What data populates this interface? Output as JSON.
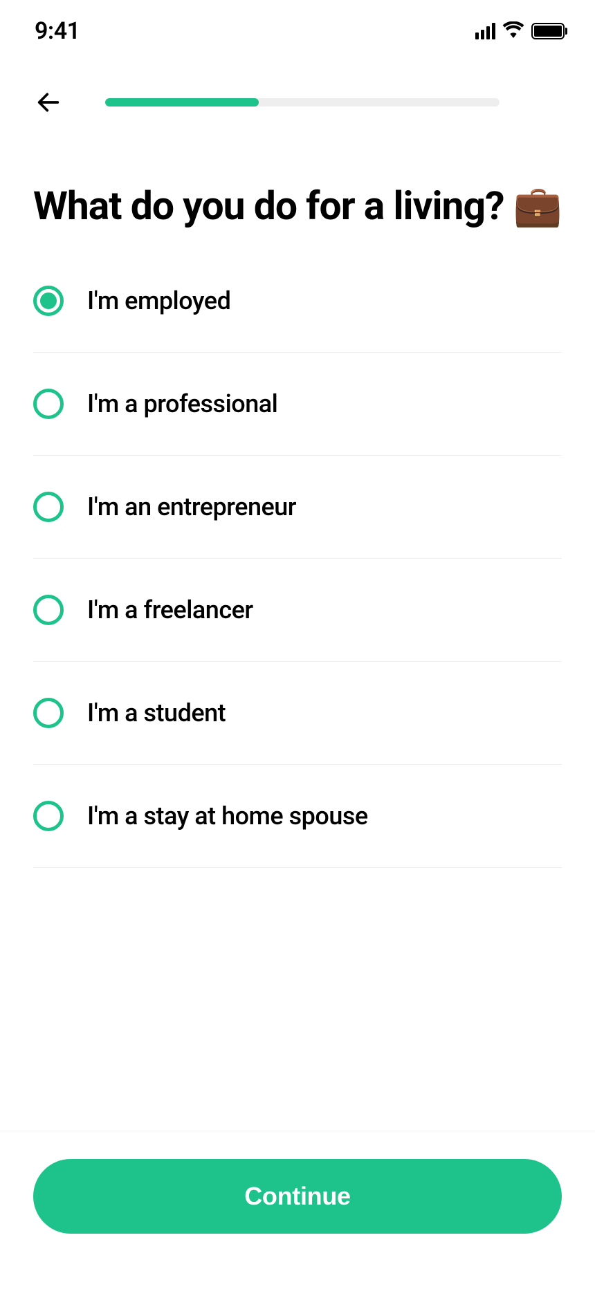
{
  "status": {
    "time": "9:41"
  },
  "progress": {
    "percent": 39
  },
  "title": "What do you do for a living? 💼",
  "options": [
    {
      "label": "I'm employed",
      "selected": true
    },
    {
      "label": "I'm a professional",
      "selected": false
    },
    {
      "label": "I'm an entrepreneur",
      "selected": false
    },
    {
      "label": "I'm a freelancer",
      "selected": false
    },
    {
      "label": "I'm a student",
      "selected": false
    },
    {
      "label": "I'm a stay at home spouse",
      "selected": false
    }
  ],
  "cta": {
    "label": "Continue"
  },
  "colors": {
    "accent": "#1ec28b"
  }
}
